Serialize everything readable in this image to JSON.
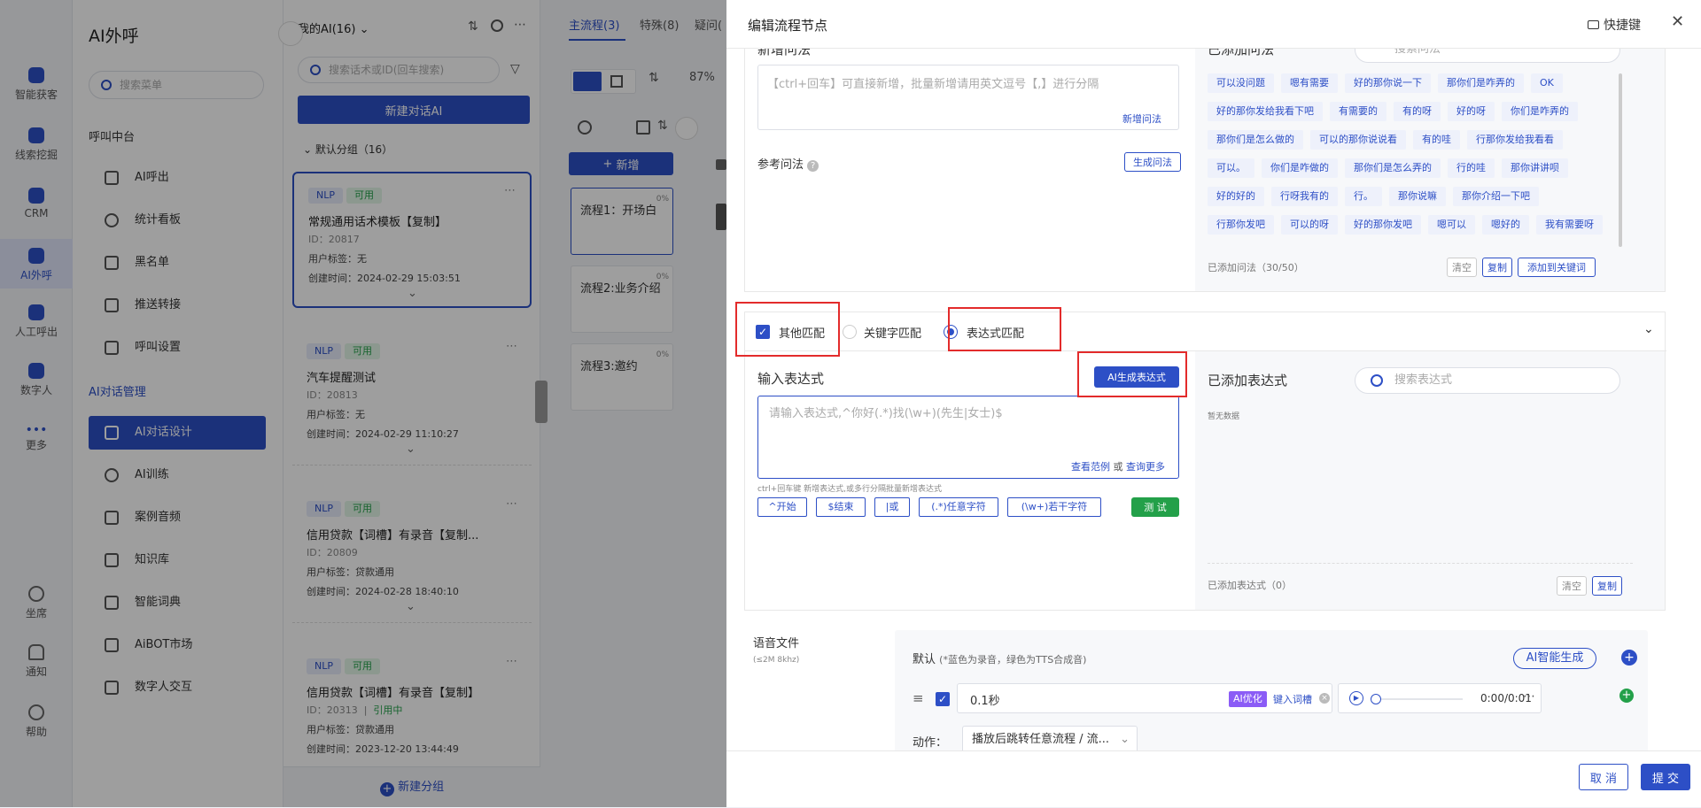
{
  "rail": {
    "items": [
      {
        "label": "智能获客",
        "icon": "target-icon"
      },
      {
        "label": "线索挖掘",
        "icon": "clue-icon"
      },
      {
        "label": "CRM",
        "icon": "crm-icon"
      },
      {
        "label": "AI外呼",
        "icon": "ai-call-icon"
      },
      {
        "label": "人工呼出",
        "icon": "manual-call-icon"
      },
      {
        "label": "数字人",
        "icon": "digital-human-icon"
      },
      {
        "label": "更多",
        "icon": "more-icon"
      }
    ],
    "bottom": [
      {
        "label": "坐席",
        "icon": "headset-icon"
      },
      {
        "label": "通知",
        "icon": "bell-icon"
      },
      {
        "label": "帮助",
        "icon": "help-icon"
      }
    ]
  },
  "menu": {
    "title": "AI外呼",
    "search_placeholder": "搜索菜单",
    "section1": "呼叫中台",
    "call_items": [
      "AI呼出",
      "统计看板",
      "黑名单",
      "推送转接",
      "呼叫设置"
    ],
    "section2": "AI对话管理",
    "ai_items": [
      "AI对话设计",
      "AI训练",
      "案例音频",
      "知识库",
      "智能词典",
      "AiBOT市场",
      "数字人交互"
    ]
  },
  "ailist": {
    "header": "我的AI(16)",
    "search_placeholder": "搜索话术或ID(回车搜索)",
    "new_button": "新建对话AI",
    "group": "默认分组（16）",
    "cards": [
      {
        "nlp": "NLP",
        "status": "可用",
        "name": "常规通用话术模板【复制】",
        "id": "ID：20817",
        "tag": "用户标签：无",
        "time": "创建时间：2024-02-29 15:03:51"
      },
      {
        "nlp": "NLP",
        "status": "可用",
        "name": "汽车提醒测试",
        "id": "ID：20813",
        "tag": "用户标签：无",
        "time": "创建时间：2024-02-29 11:10:27"
      },
      {
        "nlp": "NLP",
        "status": "可用",
        "name": "信用贷款【词槽】有录音【复制...",
        "id": "ID：20809",
        "tag": "用户标签：贷款通用",
        "time": "创建时间：2024-02-28 18:40:10"
      },
      {
        "nlp": "NLP",
        "status": "可用",
        "name": "信用贷款【词槽】有录音【复制】",
        "id": "ID：20313",
        "ref": "引用中",
        "tag": "用户标签：贷款通用",
        "time": "创建时间：2023-12-20 13:44:49"
      }
    ],
    "new_group": "新建分组"
  },
  "flow": {
    "tabs": [
      "主流程(3)",
      "特殊(8)",
      "疑问("
    ],
    "percent": "87%",
    "add_button": "新增",
    "nodes": [
      {
        "name": "流程1：开场白",
        "pct": "0%"
      },
      {
        "name": "流程2:业务介绍",
        "pct": "0%"
      },
      {
        "name": "流程3:邀约",
        "pct": "0%"
      }
    ]
  },
  "drawer": {
    "title": "编辑流程节点",
    "shortcut": "快捷键",
    "new_q_label": "新增问法",
    "new_q_placeholder": "【ctrl+回车】可直接新增，批量新增请用英文逗号【,】进行分隔",
    "new_q_link": "新增问法",
    "ref_label": "参考问法",
    "gen_button": "生成问法",
    "added_q_title": "已添加问法",
    "added_q_search": "搜索问法",
    "chips": [
      "可以没问题",
      "嗯有需要",
      "好的那你说一下",
      "那你们是咋弄的",
      "OK",
      "好的那你发给我看下吧",
      "有需要的",
      "有的呀",
      "好的呀",
      "你们是咋弄的",
      "那你们是怎么做的",
      "可以的那你说说看",
      "有的哇",
      "行那你发给我看看",
      "可以。",
      "你们是咋做的",
      "那你们是怎么弄的",
      "行的哇",
      "那你讲讲呗",
      "好的好的",
      "行呀我有的",
      "行。",
      "那你说嘛",
      "那你介绍一下吧",
      "行那你发吧",
      "可以的呀",
      "好的那你发吧",
      "嗯可以",
      "嗯好的",
      "我有需要呀"
    ],
    "added_q_count": "已添加问法（30/50）",
    "clear": "清空",
    "copy": "复制",
    "add_kw": "添加到关键词",
    "match_other": "其他匹配",
    "match_keyword": "关键字匹配",
    "match_expr": "表达式匹配",
    "expr_label": "输入表达式",
    "ai_expr_button": "AI生成表达式",
    "expr_placeholder": "请输入表达式,^你好(.*)找(\\w+)(先生|女士)$",
    "view_example": "查看范例",
    "or": "或",
    "query_more": "查询更多",
    "expr_hint": "ctrl+回车键 新增表达式,或多行分隔批量新增表达式",
    "ops": [
      "^开始",
      "$结束",
      "|或",
      "(.*)任意字符",
      "(\\w+)若干字符"
    ],
    "test": "测 试",
    "added_expr_title": "已添加表达式",
    "added_expr_search": "搜索表达式",
    "no_data": "暂无数据",
    "added_expr_count": "已添加表达式（0）",
    "voice_label": "语音文件",
    "voice_sub": "(≤2M 8khz)",
    "default": "默认",
    "default_hint": "(*蓝色为录音，绿色为TTS合成音)",
    "ai_gen": "AI智能生成",
    "voice_text": "0.1秒",
    "ai_opt": "AI优化",
    "slot": "键入词槽",
    "audio_time": "0:00/0:01",
    "action_label": "动作：",
    "action_value": "播放后跳转任意流程 / 流...",
    "cancel": "取 消",
    "submit": "提 交"
  }
}
